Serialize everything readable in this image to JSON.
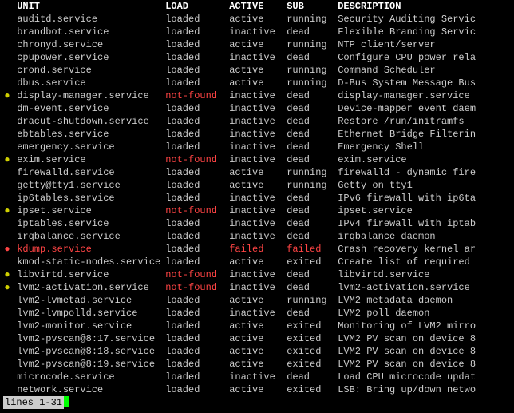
{
  "header": {
    "unit": "UNIT",
    "load": "LOAD",
    "active": "ACTIVE",
    "sub": "SUB",
    "desc": "DESCRIPTION"
  },
  "rows": [
    {
      "bullet": "",
      "unit": "auditd.service",
      "load": "loaded",
      "active": "active",
      "sub": "running",
      "desc": "Security Auditing Servic",
      "c": ""
    },
    {
      "bullet": "",
      "unit": "brandbot.service",
      "load": "loaded",
      "active": "inactive",
      "sub": "dead",
      "desc": "Flexible Branding Servic",
      "c": ""
    },
    {
      "bullet": "",
      "unit": "chronyd.service",
      "load": "loaded",
      "active": "active",
      "sub": "running",
      "desc": "NTP client/server",
      "c": ""
    },
    {
      "bullet": "",
      "unit": "cpupower.service",
      "load": "loaded",
      "active": "inactive",
      "sub": "dead",
      "desc": "Configure CPU power rela",
      "c": ""
    },
    {
      "bullet": "",
      "unit": "crond.service",
      "load": "loaded",
      "active": "active",
      "sub": "running",
      "desc": "Command Scheduler",
      "c": ""
    },
    {
      "bullet": "",
      "unit": "dbus.service",
      "load": "loaded",
      "active": "active",
      "sub": "running",
      "desc": "D-Bus System Message Bus",
      "c": ""
    },
    {
      "bullet": "●",
      "bc": "yellow",
      "unit": "display-manager.service",
      "load": "not-found",
      "lc": "red",
      "active": "inactive",
      "sub": "dead",
      "desc": "display-manager.service",
      "c": ""
    },
    {
      "bullet": "",
      "unit": "dm-event.service",
      "load": "loaded",
      "active": "inactive",
      "sub": "dead",
      "desc": "Device-mapper event daem",
      "c": ""
    },
    {
      "bullet": "",
      "unit": "dracut-shutdown.service",
      "load": "loaded",
      "active": "inactive",
      "sub": "dead",
      "desc": "Restore /run/initramfs",
      "c": ""
    },
    {
      "bullet": "",
      "unit": "ebtables.service",
      "load": "loaded",
      "active": "inactive",
      "sub": "dead",
      "desc": "Ethernet Bridge Filterin",
      "c": ""
    },
    {
      "bullet": "",
      "unit": "emergency.service",
      "load": "loaded",
      "active": "inactive",
      "sub": "dead",
      "desc": "Emergency Shell",
      "c": ""
    },
    {
      "bullet": "●",
      "bc": "yellow",
      "unit": "exim.service",
      "load": "not-found",
      "lc": "red",
      "active": "inactive",
      "sub": "dead",
      "desc": "exim.service",
      "c": ""
    },
    {
      "bullet": "",
      "unit": "firewalld.service",
      "load": "loaded",
      "active": "active",
      "sub": "running",
      "desc": "firewalld - dynamic fire",
      "c": ""
    },
    {
      "bullet": "",
      "unit": "getty@tty1.service",
      "load": "loaded",
      "active": "active",
      "sub": "running",
      "desc": "Getty on tty1",
      "c": ""
    },
    {
      "bullet": "",
      "unit": "ip6tables.service",
      "load": "loaded",
      "active": "inactive",
      "sub": "dead",
      "desc": "IPv6 firewall with ip6ta",
      "c": ""
    },
    {
      "bullet": "●",
      "bc": "yellow",
      "unit": "ipset.service",
      "load": "not-found",
      "lc": "red",
      "active": "inactive",
      "sub": "dead",
      "desc": "ipset.service",
      "c": ""
    },
    {
      "bullet": "",
      "unit": "iptables.service",
      "load": "loaded",
      "active": "inactive",
      "sub": "dead",
      "desc": "IPv4 firewall with iptab",
      "c": ""
    },
    {
      "bullet": "",
      "unit": "irqbalance.service",
      "load": "loaded",
      "active": "inactive",
      "sub": "dead",
      "desc": "irqbalance daemon",
      "c": ""
    },
    {
      "bullet": "●",
      "bc": "red",
      "unit": "kdump.service",
      "uc": "red",
      "load": "loaded",
      "active": "failed",
      "ac": "red",
      "sub": "failed",
      "sc": "red",
      "desc": "Crash recovery kernel ar",
      "c": ""
    },
    {
      "bullet": "",
      "unit": "kmod-static-nodes.service",
      "load": "loaded",
      "active": "active",
      "sub": "exited",
      "desc": "Create list of required ",
      "c": ""
    },
    {
      "bullet": "●",
      "bc": "yellow",
      "unit": "libvirtd.service",
      "load": "not-found",
      "lc": "red",
      "active": "inactive",
      "sub": "dead",
      "desc": "libvirtd.service",
      "c": ""
    },
    {
      "bullet": "●",
      "bc": "yellow",
      "unit": "lvm2-activation.service",
      "load": "not-found",
      "lc": "red",
      "active": "inactive",
      "sub": "dead",
      "desc": "lvm2-activation.service",
      "c": ""
    },
    {
      "bullet": "",
      "unit": "lvm2-lvmetad.service",
      "load": "loaded",
      "active": "active",
      "sub": "running",
      "desc": "LVM2 metadata daemon",
      "c": ""
    },
    {
      "bullet": "",
      "unit": "lvm2-lvmpolld.service",
      "load": "loaded",
      "active": "inactive",
      "sub": "dead",
      "desc": "LVM2 poll daemon",
      "c": ""
    },
    {
      "bullet": "",
      "unit": "lvm2-monitor.service",
      "load": "loaded",
      "active": "active",
      "sub": "exited",
      "desc": "Monitoring of LVM2 mirro",
      "c": ""
    },
    {
      "bullet": "",
      "unit": "lvm2-pvscan@8:17.service",
      "load": "loaded",
      "active": "active",
      "sub": "exited",
      "desc": "LVM2 PV scan on device 8",
      "c": ""
    },
    {
      "bullet": "",
      "unit": "lvm2-pvscan@8:18.service",
      "load": "loaded",
      "active": "active",
      "sub": "exited",
      "desc": "LVM2 PV scan on device 8",
      "c": ""
    },
    {
      "bullet": "",
      "unit": "lvm2-pvscan@8:19.service",
      "load": "loaded",
      "active": "active",
      "sub": "exited",
      "desc": "LVM2 PV scan on device 8",
      "c": ""
    },
    {
      "bullet": "",
      "unit": "microcode.service",
      "load": "loaded",
      "active": "inactive",
      "sub": "dead",
      "desc": "Load CPU microcode updat",
      "c": ""
    },
    {
      "bullet": "",
      "unit": "network.service",
      "load": "loaded",
      "active": "active",
      "sub": "exited",
      "desc": "LSB: Bring up/down netwo",
      "c": ""
    }
  ],
  "status": "lines 1-31"
}
